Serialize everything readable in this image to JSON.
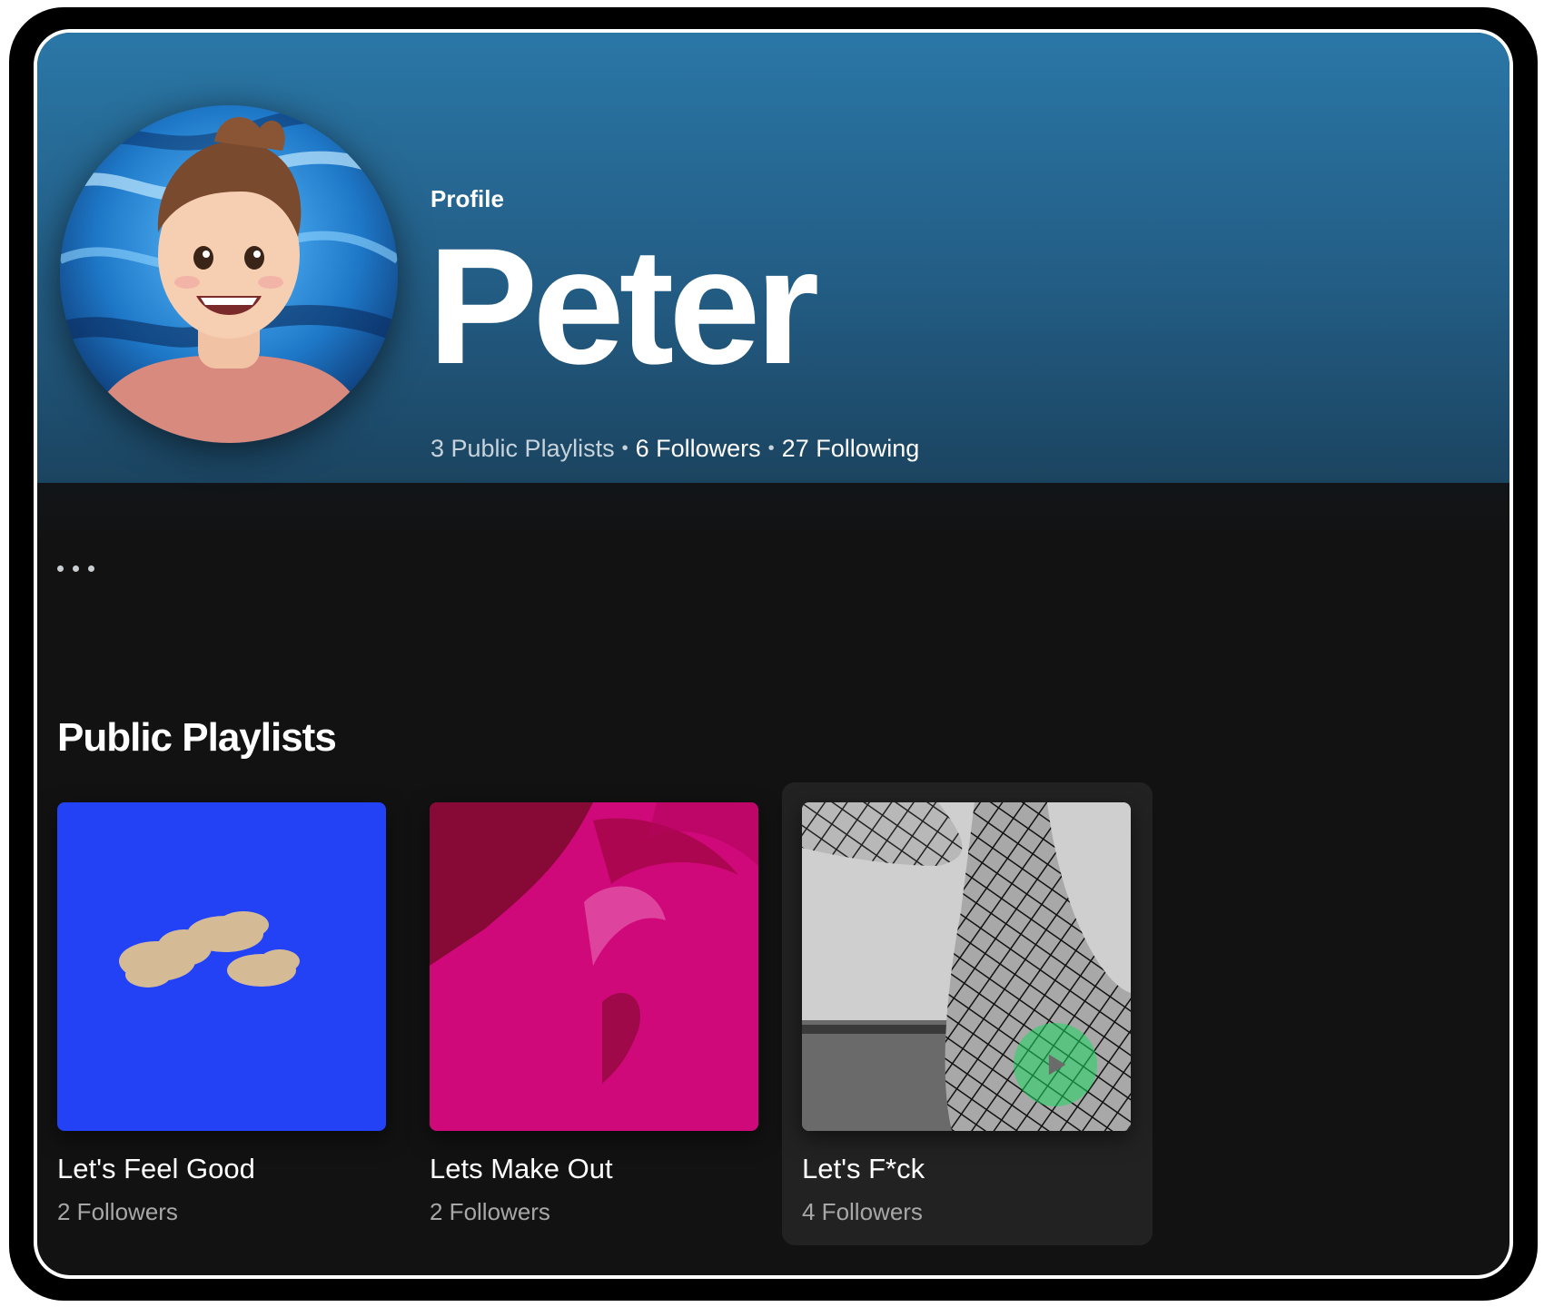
{
  "header": {
    "type_label": "Profile",
    "name": "Peter",
    "stats": {
      "public_playlists": "3 Public Playlists",
      "followers": "6 Followers",
      "following": "27 Following",
      "separator": "•"
    }
  },
  "section": {
    "title": "Public Playlists"
  },
  "playlists": [
    {
      "title": "Let's Feel Good",
      "followers": "2 Followers",
      "cover_color": "#1e3cf0",
      "cover_icon": "clouds-cover"
    },
    {
      "title": "Lets Make Out",
      "followers": "2 Followers",
      "cover_color": "#d0097a",
      "cover_icon": "pink-cover"
    },
    {
      "title": "Let's F*ck",
      "followers": "4 Followers",
      "cover_color": "#8a8a8a",
      "cover_icon": "fishnet-cover",
      "hovered": true
    }
  ],
  "colors": {
    "header_accent": "#2a77a7",
    "play_green": "#1ed760",
    "background": "#121212"
  },
  "icons": {
    "more": "more-options-icon",
    "play": "play-icon",
    "avatar": "avatar-illustration"
  }
}
